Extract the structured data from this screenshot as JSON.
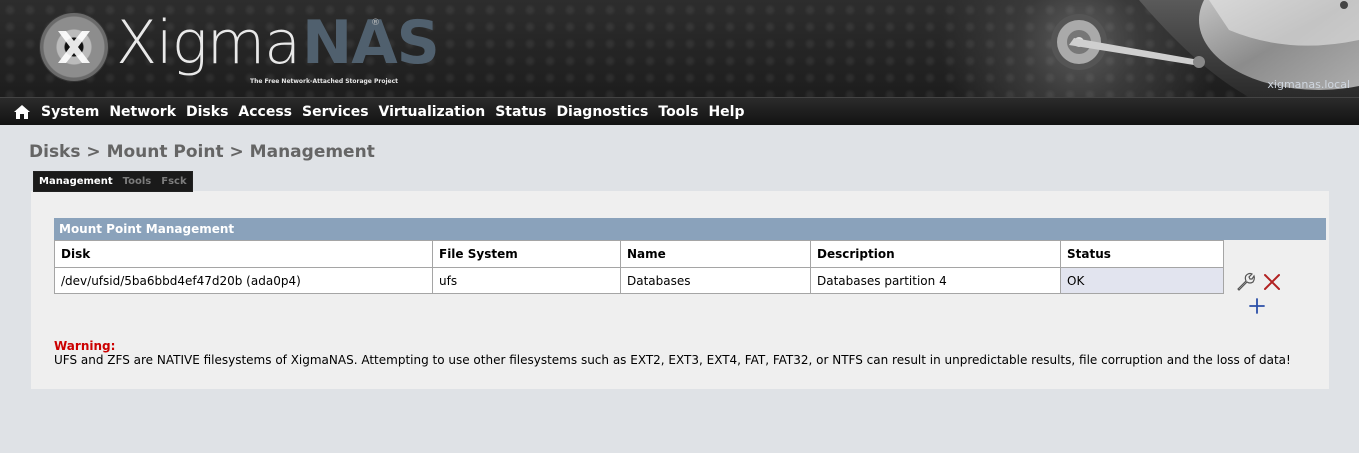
{
  "header": {
    "logo_main": "Xigma",
    "logo_accent": "NAS",
    "logo_reg": "®",
    "tagline": "The Free Network-Attached Storage Project",
    "hostname": "xigmanas.local"
  },
  "menu": {
    "items": [
      "System",
      "Network",
      "Disks",
      "Access",
      "Services",
      "Virtualization",
      "Status",
      "Diagnostics",
      "Tools",
      "Help"
    ]
  },
  "breadcrumb": "Disks > Mount Point > Management",
  "tabs": [
    {
      "label": "Management",
      "active": true
    },
    {
      "label": "Tools",
      "active": false
    },
    {
      "label": "Fsck",
      "active": false
    }
  ],
  "section": {
    "title": "Mount Point Management"
  },
  "table": {
    "columns": [
      "Disk",
      "File System",
      "Name",
      "Description",
      "Status"
    ],
    "rows": [
      {
        "disk": "/dev/ufsid/5ba6bbd4ef47d20b (ada0p4)",
        "filesystem": "ufs",
        "name": "Databases",
        "description": "Databases partition 4",
        "status": "OK"
      }
    ]
  },
  "actions": {
    "edit_icon": "wrench-icon",
    "delete_icon": "delete-x-icon",
    "add_icon": "add-plus-icon"
  },
  "warning": {
    "title": "Warning:",
    "body": "UFS and ZFS are NATIVE filesystems of XigmaNAS. Attempting to use other filesystems such as EXT2, EXT3, EXT4, FAT, FAT32, or NTFS can result in unpredictable results, file corruption and the loss of data!"
  },
  "colors": {
    "section_header": "#8aa2bb",
    "warning_title": "#cc0000",
    "delete_icon": "#b22222",
    "add_icon": "#2b4fa8",
    "status_cell": "#e2e4ef"
  }
}
